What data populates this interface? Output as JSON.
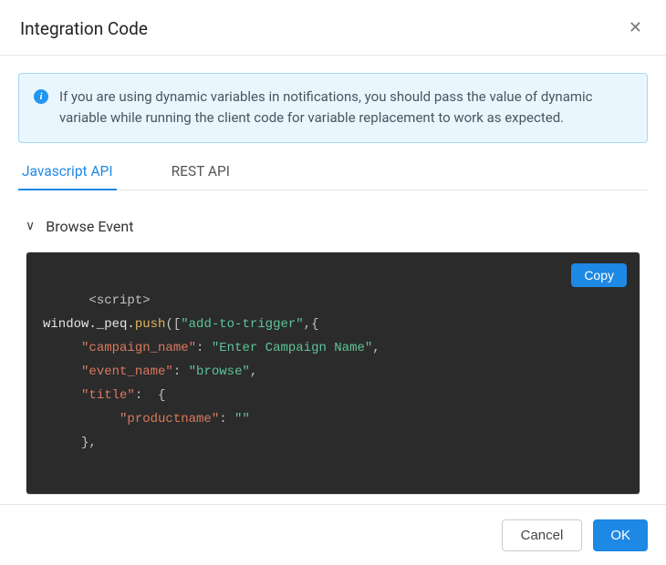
{
  "modal": {
    "title": "Integration Code",
    "close_glyph": "✕"
  },
  "alert": {
    "icon_glyph": "i",
    "text": "If you are using dynamic variables in notifications, you should pass the value of dynamic variable while running the client code for variable replacement to work as expected."
  },
  "tabs": [
    {
      "label": "Javascript API",
      "active": true
    },
    {
      "label": "REST API",
      "active": false
    }
  ],
  "section": {
    "chevron_glyph": "∨",
    "title": "Browse Event"
  },
  "code": {
    "copy_label": "Copy",
    "lines": {
      "l1_open": "<script>",
      "l2_a": "window._peq.",
      "l2_b": "push",
      "l2_c": "([",
      "l2_d": "\"add-to-trigger\"",
      "l2_e": ",{",
      "l3_k": "\"campaign_name\"",
      "l3_v": "\"Enter Campaign Name\"",
      "l4_k": "\"event_name\"",
      "l4_v": "\"browse\"",
      "l5_k": "\"title\"",
      "l6_k": "\"productname\"",
      "l6_v": "\"\"",
      "colon": ": ",
      "comma": ",",
      "brace_open": " {",
      "brace_close": "},"
    }
  },
  "footer": {
    "cancel_label": "Cancel",
    "ok_label": "OK"
  }
}
